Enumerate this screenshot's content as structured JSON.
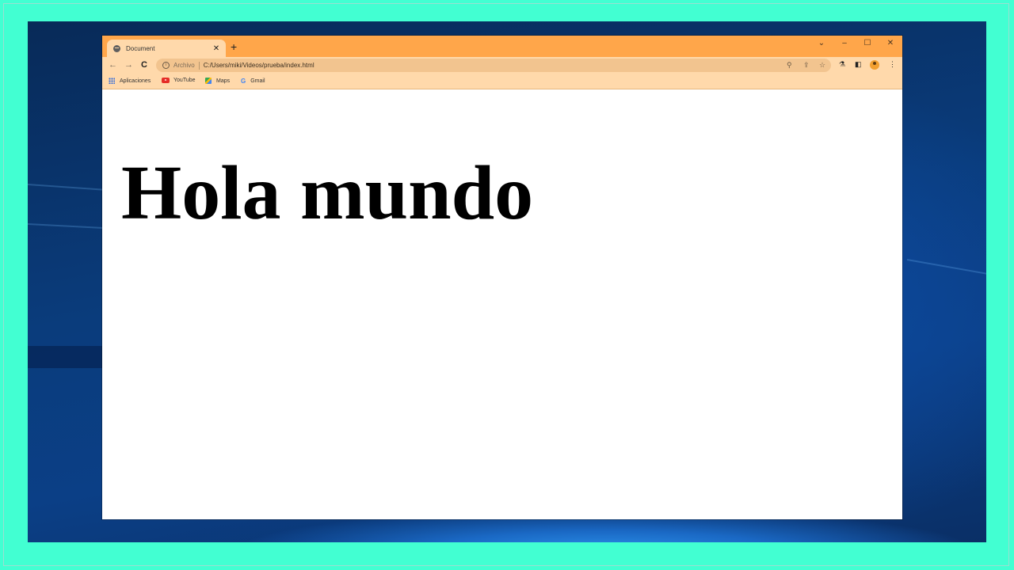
{
  "browser": {
    "tab": {
      "title": "Document",
      "close_icon": "close-icon",
      "favicon": "globe-icon"
    },
    "new_tab_label": "+",
    "window_controls": {
      "dropdown": "⌄",
      "minimize": "–",
      "maximize": "☐",
      "close": "✕"
    },
    "toolbar": {
      "back_icon": "←",
      "forward_icon": "→",
      "reload_icon": "C",
      "site_info_icon": "i",
      "scheme_label": "Archivo",
      "url": "C:/Users/miki/Videos/prueba/index.html",
      "zoom_icon": "⚲",
      "share_icon": "⇪",
      "star_icon": "☆",
      "extensions_icon": "⚗",
      "sidepanel_icon": "◧",
      "menu_icon": "⋮"
    },
    "bookmarks": [
      {
        "label": "Aplicaciones",
        "icon": "apps-grid-icon"
      },
      {
        "label": "YouTube",
        "icon": "youtube-icon"
      },
      {
        "label": "Maps",
        "icon": "maps-icon"
      },
      {
        "label": "Gmail",
        "icon": "google-g-icon"
      }
    ],
    "google_g": "G"
  },
  "page": {
    "heading": "Hola mundo"
  },
  "colors": {
    "titlebar": "#ffa64a",
    "toolbar": "#ffd9ab",
    "outer_border": "#42ffd2"
  }
}
